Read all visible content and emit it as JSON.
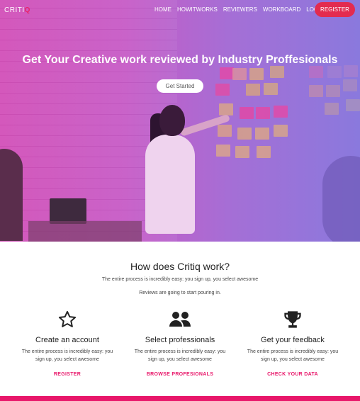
{
  "brand": {
    "logo_text": "CRITI",
    "logo_accent": "Q",
    "accent_color": "#e8176a"
  },
  "nav": {
    "items": [
      {
        "label": "HOME"
      },
      {
        "label": "HOWITWORKS"
      },
      {
        "label": "REVIEWERS"
      },
      {
        "label": "WORKBOARD"
      },
      {
        "label": "LOGIN"
      }
    ],
    "register_label": "REGISTER"
  },
  "hero": {
    "title": "Get Your Creative work reviewed by Industry Proffesionals",
    "cta_label": "Get Started"
  },
  "how": {
    "title": "How does Critiq work?",
    "subtitle": "The entire process is incredibly easy: you sign up, you select awesome",
    "subtitle2": "Reviews are going to start pouring in.",
    "steps": [
      {
        "icon": "star-icon",
        "title": "Create an account",
        "desc": "The entire process is incredibly easy: you sign up, you select awesome",
        "link": "REGISTER"
      },
      {
        "icon": "users-icon",
        "title": "Select professionals",
        "desc": "The entire process is incredibly easy: you sign up, you select awesome",
        "link": "BROWSE PROFESIONALS"
      },
      {
        "icon": "trophy-icon",
        "title": "Get your feedback",
        "desc": "The entire process is incredibly easy: you sign up, you select awesome",
        "link": "CHECK YOUR DATA"
      }
    ]
  }
}
